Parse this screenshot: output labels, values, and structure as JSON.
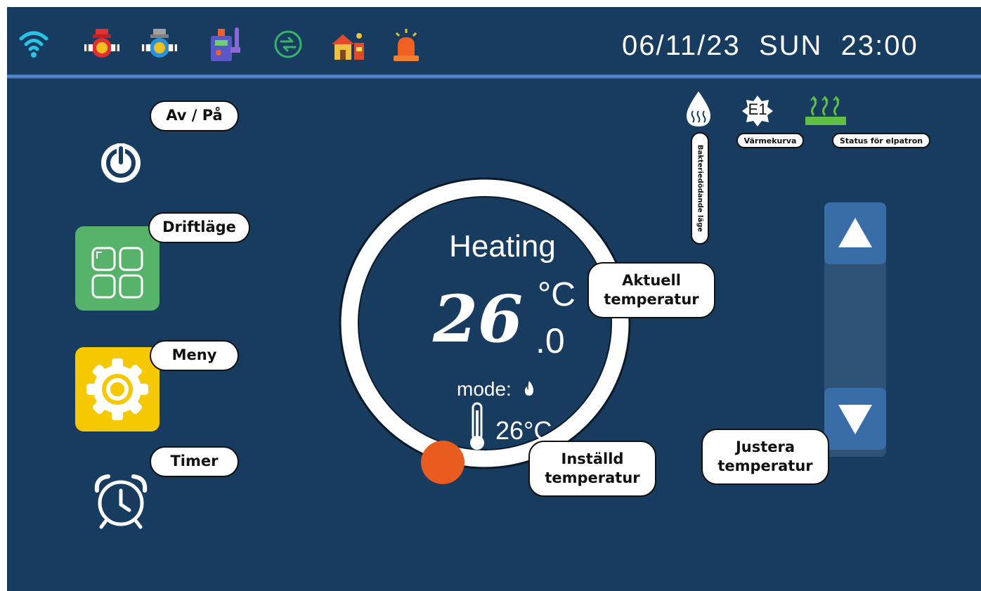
{
  "status_bar": {
    "datetime": "06/11/23  SUN  23:00",
    "icons": [
      "wifi-icon",
      "circulation-pump-red-icon",
      "circulation-pump-blue-icon",
      "compressor-icon",
      "defrost-icon",
      "house-heating-icon",
      "alarm-icon"
    ]
  },
  "left_menu": {
    "power_label": "Av / På",
    "mode_label": "Driftläge",
    "menu_label": "Meny",
    "timer_label": "Timer"
  },
  "dial": {
    "mode_title": "Heating",
    "current_temp_int": "26",
    "current_temp_dec": ".0",
    "unit": "°C",
    "mode_prefix": "mode:",
    "set_temp": "26°C",
    "current_temp_callout": "Aktuell temperatur",
    "set_temp_callout": "Inställd temperatur"
  },
  "indicators": {
    "sterilization_label": "Bakteriedödande läge",
    "heat_curve_badge": "E1",
    "heat_curve_label": "Värmekurva",
    "heater_status_label": "Status för elpatron"
  },
  "adjust": {
    "callout": "Justera temperatur"
  },
  "colors": {
    "background": "#173c5f",
    "knob": "#ea5b20",
    "mode_tile": "#58b36a",
    "menu_tile": "#f5c800",
    "button": "#386da8"
  }
}
